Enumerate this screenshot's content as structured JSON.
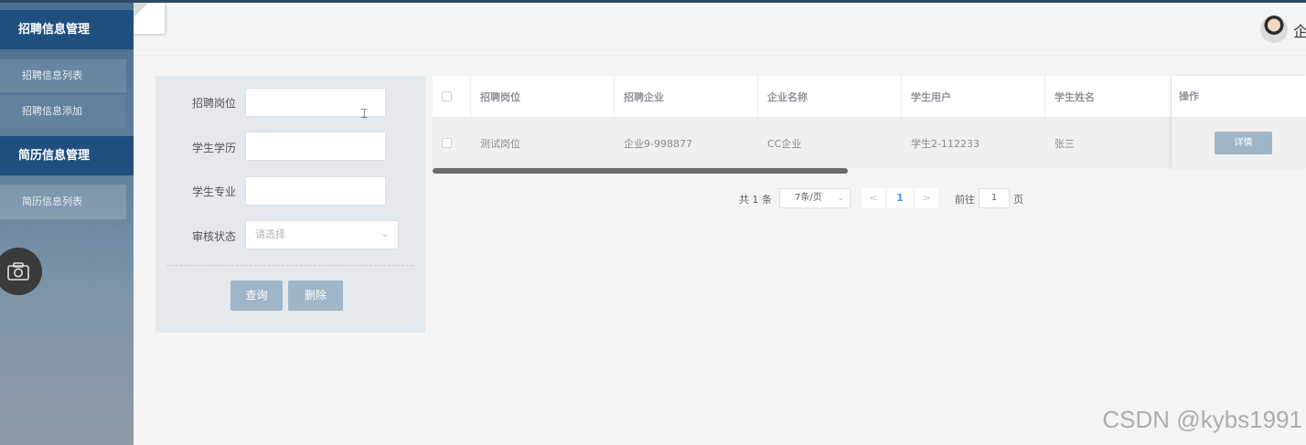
{
  "sidebar": {
    "groups": [
      {
        "label": "招聘信息管理",
        "items": [
          "招聘信息列表",
          "招聘信息添加"
        ]
      },
      {
        "label": "简历信息管理",
        "items": [
          "简历信息列表"
        ]
      }
    ]
  },
  "header": {
    "user_name": "企"
  },
  "search": {
    "fields": [
      {
        "label": "招聘岗位",
        "value": ""
      },
      {
        "label": "学生学历",
        "value": ""
      },
      {
        "label": "学生专业",
        "value": ""
      }
    ],
    "status": {
      "label": "审核状态",
      "placeholder": "请选择"
    },
    "query_label": "查询",
    "delete_label": "删除"
  },
  "table": {
    "columns": [
      "招聘岗位",
      "招聘企业",
      "企业名称",
      "学生用户",
      "学生姓名",
      "操作"
    ],
    "rows": [
      {
        "cells": [
          "测试岗位",
          "企业9-998877",
          "CC企业",
          "学生2-112233",
          "张三"
        ],
        "action_label": "详情"
      }
    ]
  },
  "pagination": {
    "total_text": "共 1 条",
    "page_size": "7条/页",
    "prev": "<",
    "current_page": "1",
    "next": ">",
    "goto_label": "前往",
    "goto_value": "1",
    "goto_unit": "页"
  },
  "watermark": "CSDN @kybs1991"
}
